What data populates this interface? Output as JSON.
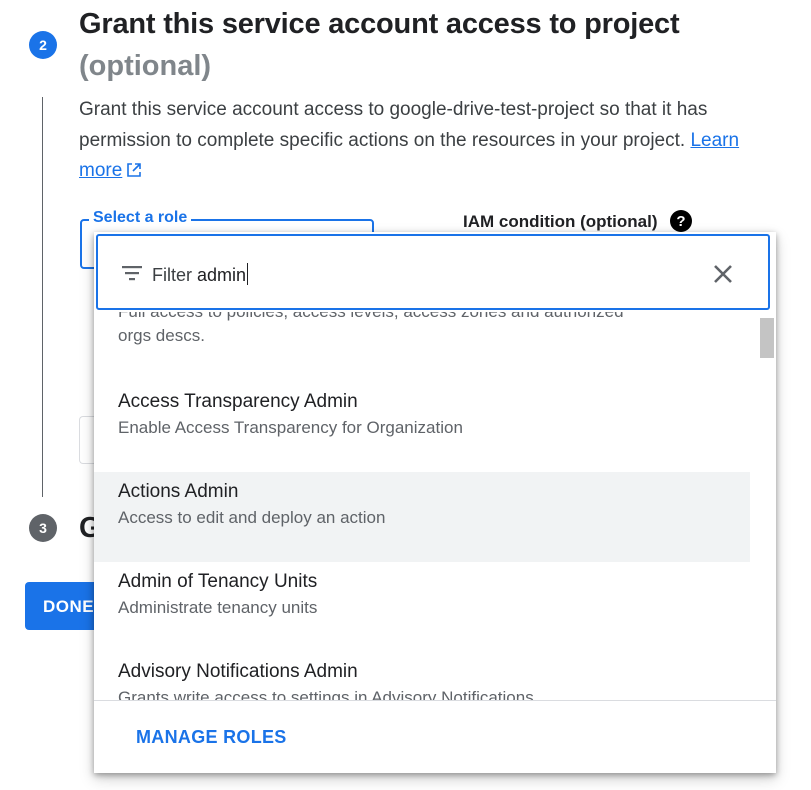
{
  "step2": {
    "number": "2",
    "title": "Grant this service account access to project",
    "optional": "(optional)",
    "description": "Grant this service account access to google-drive-test-project so that it has permission to complete specific actions on the resources in your project.",
    "learn_more": "Learn more"
  },
  "form": {
    "role_label": "Select a role",
    "iam_label": "IAM condition (optional)",
    "help_icon": "?"
  },
  "step3": {
    "number": "3",
    "title_fragment": "G",
    "paren_fragment": ")"
  },
  "done_label": "DONE",
  "dropdown": {
    "filter_label": "Filter",
    "filter_value": "admin",
    "roles": [
      {
        "title": "",
        "description_line1": "Full access to policies, access levels, access zones and authorized",
        "description_line2": "orgs descs."
      },
      {
        "title": "Access Transparency Admin",
        "description": "Enable Access Transparency for Organization"
      },
      {
        "title": "Actions Admin",
        "description": "Access to edit and deploy an action"
      },
      {
        "title": "Admin of Tenancy Units",
        "description": "Administrate tenancy units"
      },
      {
        "title": "Advisory Notifications Admin",
        "description": "Grants write access to settings in Advisory Notifications"
      }
    ],
    "manage_roles": "MANAGE ROLES"
  },
  "colors": {
    "accent": "#1a73e8",
    "highlight": "#f1f3f4",
    "muted": "#5f6368"
  }
}
